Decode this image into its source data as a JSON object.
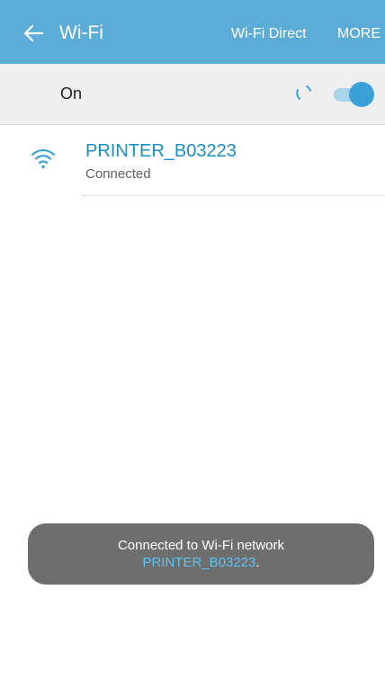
{
  "app_bar": {
    "back_icon": "arrow-left-icon",
    "title": "Wi-Fi",
    "wifi_direct_label": "Wi-Fi Direct",
    "more_label": "MORE",
    "background_color": "#5bacd6"
  },
  "switch_bar": {
    "label": "On",
    "spinner_icon": "loading-spinner-icon",
    "toggle_on": true,
    "toggle_color": "#3aa0d8"
  },
  "networks": [
    {
      "icon": "wifi-signal-icon",
      "name": "PRINTER_B03223",
      "status": "Connected"
    }
  ],
  "toast": {
    "line1": "Connected to Wi-Fi network",
    "network_name": "PRINTER_B03223",
    "period": "."
  }
}
